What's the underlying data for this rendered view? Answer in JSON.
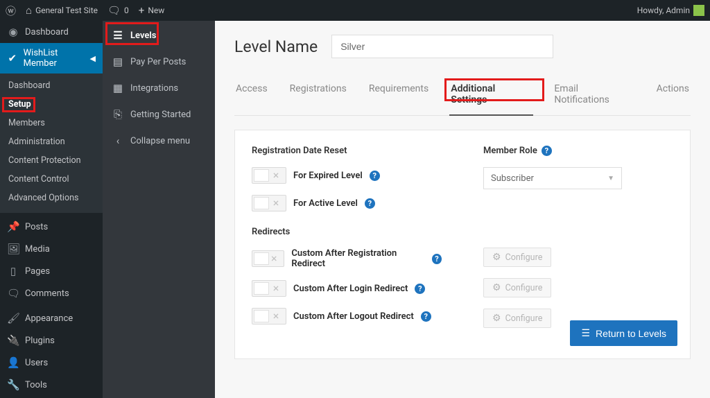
{
  "adminbar": {
    "site_name": "General Test Site",
    "comments_count": "0",
    "new_label": "New",
    "howdy": "Howdy, Admin"
  },
  "sidebar1": {
    "dashboard": "Dashboard",
    "wishlist": "WishList Member",
    "posts": "Posts",
    "media": "Media",
    "pages": "Pages",
    "comments": "Comments",
    "appearance": "Appearance",
    "plugins": "Plugins",
    "users": "Users",
    "tools": "Tools",
    "sub": {
      "dashboard": "Dashboard",
      "setup": "Setup",
      "members": "Members",
      "administration": "Administration",
      "content_protection": "Content Protection",
      "content_control": "Content Control",
      "advanced_options": "Advanced Options"
    }
  },
  "sidebar2": {
    "levels": "Levels",
    "payperposts": "Pay Per Posts",
    "integrations": "Integrations",
    "getting_started": "Getting Started",
    "collapse": "Collapse menu"
  },
  "main": {
    "heading": "Level Name",
    "level_value": "Silver",
    "tabs": {
      "access": "Access",
      "registrations": "Registrations",
      "requirements": "Requirements",
      "additional": "Additional Settings",
      "email": "Email Notifications",
      "actions": "Actions"
    },
    "sections": {
      "reg_date_reset": "Registration Date Reset",
      "for_expired": "For Expired Level",
      "for_active": "For Active Level",
      "member_role": "Member Role",
      "role_value": "Subscriber",
      "redirects": "Redirects",
      "after_reg": "Custom After Registration Redirect",
      "after_login": "Custom After Login Redirect",
      "after_logout": "Custom After Logout Redirect",
      "configure": "Configure"
    },
    "return_btn": "Return to Levels"
  }
}
